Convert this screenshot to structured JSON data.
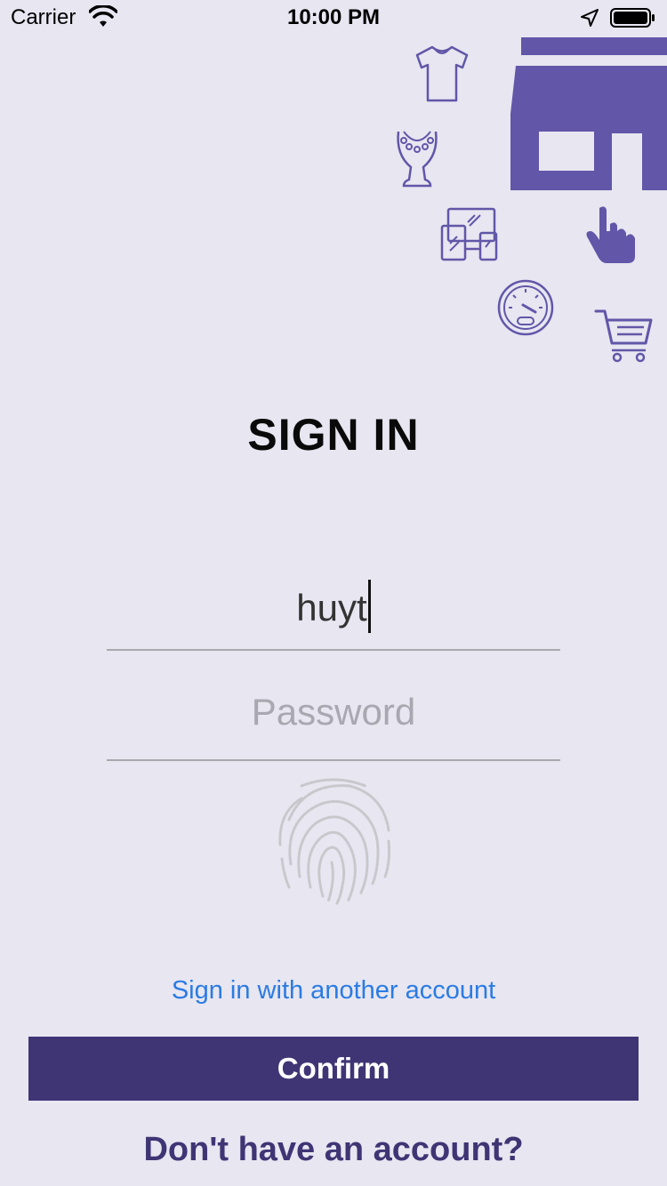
{
  "status_bar": {
    "carrier": "Carrier",
    "time": "10:00 PM",
    "icons": [
      "wifi-icon",
      "location-arrow-icon",
      "battery-icon"
    ]
  },
  "decorations": {
    "icons": [
      "tshirt-icon",
      "necklace-icon",
      "devices-icon",
      "speedometer-icon",
      "store-icon",
      "pointer-hand-icon",
      "cart-icon"
    ],
    "accent_color": "#6256a8"
  },
  "form": {
    "title": "SIGN IN",
    "username_value": "huyt",
    "password_placeholder": "Password",
    "fingerprint_icon": "fingerprint-icon",
    "alt_account_link": "Sign in with another account",
    "confirm_label": "Confirm",
    "register_link": "Don't have an account?"
  },
  "colors": {
    "background": "#e7e6f1",
    "primary": "#3f3574",
    "link": "#2b7be3",
    "divider": "#a9a9ad"
  }
}
